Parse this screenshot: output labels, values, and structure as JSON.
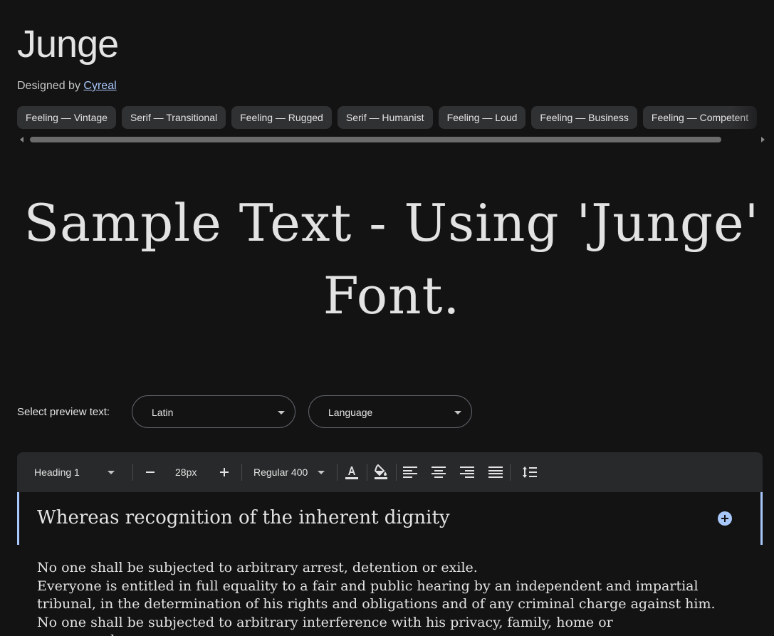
{
  "font": {
    "name": "Junge",
    "designed_by_label": "Designed by",
    "designer": "Cyreal"
  },
  "tags": [
    "Feeling — Vintage",
    "Serif — Transitional",
    "Feeling — Rugged",
    "Serif — Humanist",
    "Feeling — Loud",
    "Feeling — Business",
    "Feeling — Competent"
  ],
  "hero": {
    "text": "Sample Text - Using 'Junge' Font."
  },
  "preview": {
    "label": "Select preview text:",
    "script_select": "Latin",
    "language_select": "Language"
  },
  "toolbar": {
    "style": "Heading 1",
    "size": "28px",
    "weight": "Regular 400"
  },
  "editor": {
    "heading": "Whereas recognition of the inherent dignity",
    "paragraphs": [
      "No one shall be subjected to arbitrary arrest, detention or exile.",
      "Everyone is entitled in full equality to a fair and public hearing by an independent and impartial tribunal, in the determination of his rights and obligations and of any criminal charge against him.",
      "No one shall be subjected to arbitrary interference with his privacy, family, home or correspondence."
    ]
  },
  "colors": {
    "background": "#131314",
    "accent": "#a8c7fa",
    "chip": "#303133",
    "toolbar": "#28292a"
  }
}
